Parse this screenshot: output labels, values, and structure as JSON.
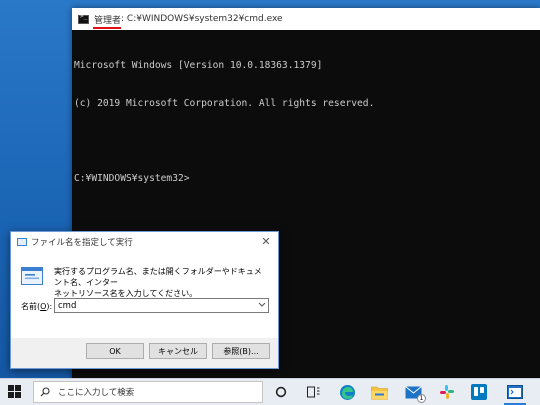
{
  "cmd": {
    "title_admin": "管理者",
    "title_path": ": C:¥WINDOWS¥system32¥cmd.exe",
    "lines": [
      "Microsoft Windows [Version 10.0.18363.1379]",
      "(c) 2019 Microsoft Corporation. All rights reserved.",
      "",
      "C:¥WINDOWS¥system32>"
    ]
  },
  "run_dialog": {
    "title": "ファイル名を指定して実行",
    "close_glyph": "✕",
    "description_line1": "実行するプログラム名、または開くフォルダーやドキュメント名、インター",
    "description_line2": "ネットリソース名を入力してください。",
    "name_label_prefix": "名前(",
    "name_label_key": "O",
    "name_label_suffix": "):",
    "input_value": "cmd",
    "ok_label": "OK",
    "cancel_label": "キャンセル",
    "browse_label": "参照(B)..."
  },
  "taskbar": {
    "search_placeholder": "ここに入力して検索",
    "mail_badge": "1",
    "icons": [
      "start-icon",
      "search-icon",
      "cortana-icon",
      "task-view-icon",
      "edge-icon",
      "file-explorer-icon",
      "mail-icon",
      "slack-icon",
      "trello-icon",
      "command-prompt-icon"
    ]
  },
  "colors": {
    "accent": "#2a7ad8",
    "desktop": "#1f6fc0",
    "console_bg": "#0c0c0c",
    "admin_underline": "#e01010"
  }
}
